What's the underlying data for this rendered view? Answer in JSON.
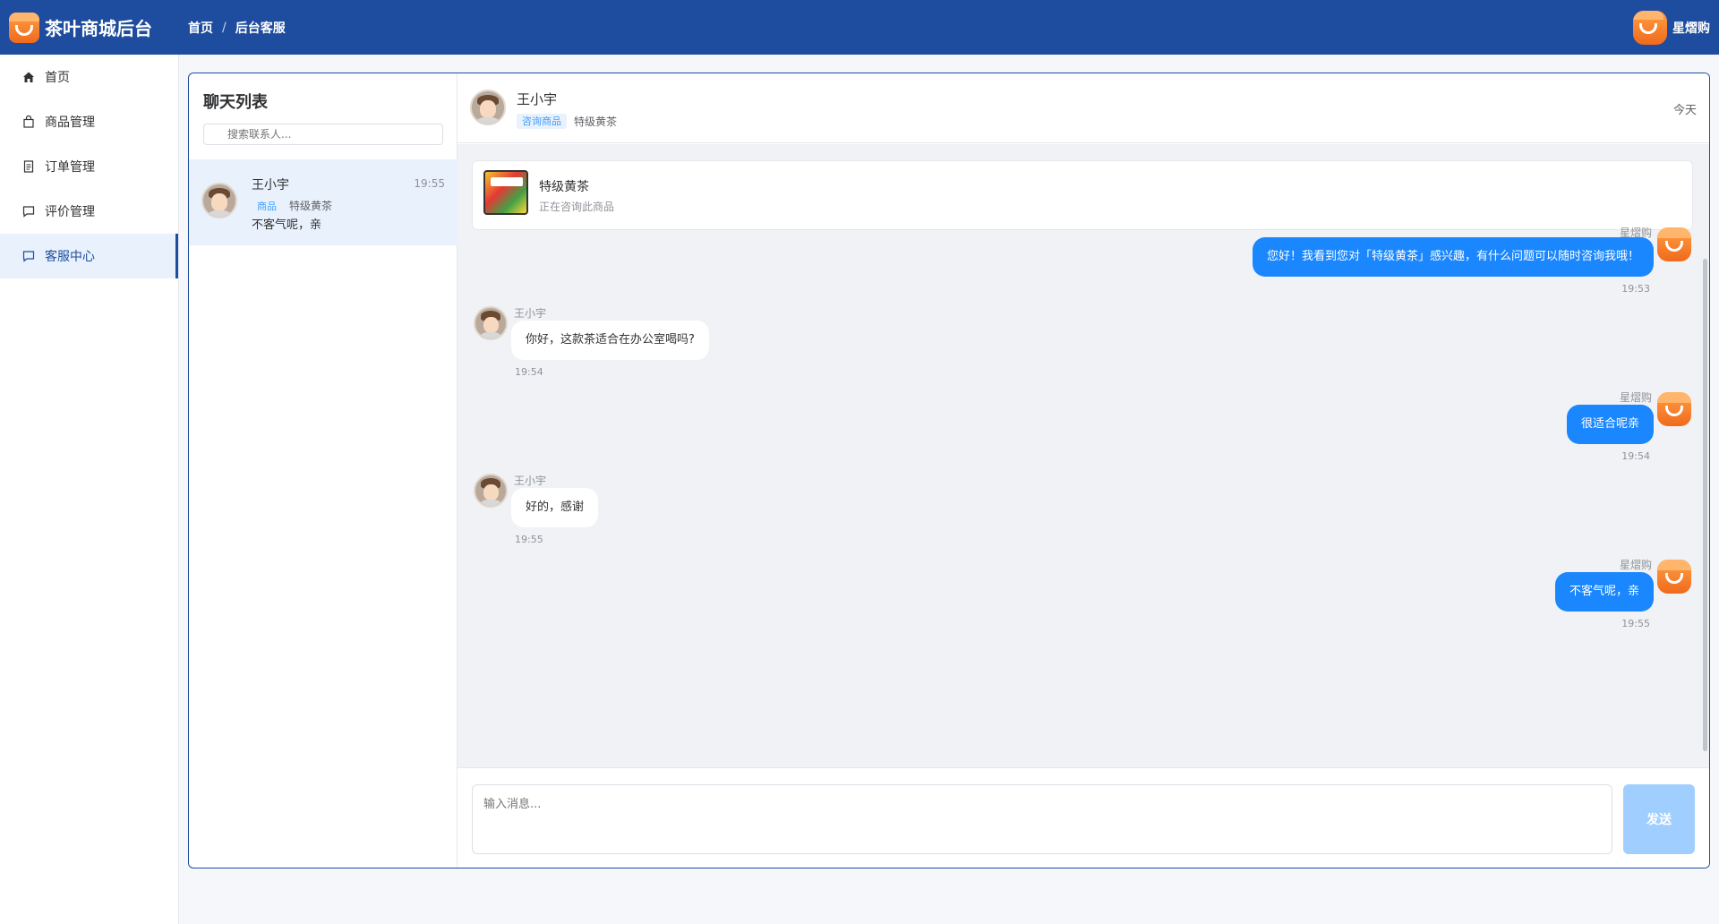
{
  "app": {
    "title": "茶叶商城后台"
  },
  "breadcrumb": {
    "home": "首页",
    "separator": "/",
    "current": "后台客服"
  },
  "user": {
    "name": "星熠购"
  },
  "sidebar": {
    "items": [
      {
        "label": "首页",
        "icon": "home-icon"
      },
      {
        "label": "商品管理",
        "icon": "bag-icon"
      },
      {
        "label": "订单管理",
        "icon": "document-icon"
      },
      {
        "label": "评价管理",
        "icon": "comment-icon"
      },
      {
        "label": "客服中心",
        "icon": "chat-icon",
        "active": true
      }
    ]
  },
  "chat_list": {
    "title": "聊天列表",
    "search_placeholder": "搜索联系人...",
    "contacts": [
      {
        "name": "王小宇",
        "time": "19:55",
        "tag": "商品",
        "product": "特级黄茶",
        "last_message": "不客气呢，亲"
      }
    ]
  },
  "chat": {
    "name": "王小宇",
    "tag": "咨询商品",
    "product": "特级黄茶",
    "date_label": "今天",
    "product_card": {
      "name": "特级黄茶",
      "subtitle": "正在咨询此商品"
    },
    "messages": [
      {
        "side": "right",
        "sender": "星熠购",
        "text": "您好！我看到您对「特级黄茶」感兴趣，有什么问题可以随时咨询我哦！",
        "time": "19:53"
      },
      {
        "side": "left",
        "sender": "王小宇",
        "text": "你好，这款茶适合在办公室喝吗?",
        "time": "19:54"
      },
      {
        "side": "right",
        "sender": "星熠购",
        "text": "很适合呢亲",
        "time": "19:54"
      },
      {
        "side": "left",
        "sender": "王小宇",
        "text": "好的，感谢",
        "time": "19:55"
      },
      {
        "side": "right",
        "sender": "星熠购",
        "text": "不客气呢，亲",
        "time": "19:55"
      }
    ],
    "input_placeholder": "输入消息...",
    "send_label": "发送"
  },
  "colors": {
    "header": "#1e4c9e",
    "accent": "#1a87ff",
    "send_disabled": "#a0cfff",
    "active_bg": "#e8f1fc"
  }
}
